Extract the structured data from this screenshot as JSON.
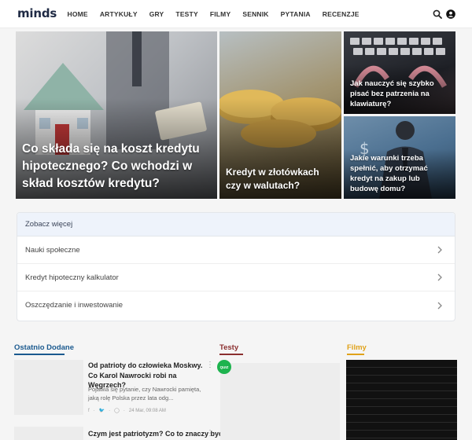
{
  "header": {
    "logo": "minds",
    "nav": [
      "HOME",
      "ARTYKUŁY",
      "GRY",
      "TESTY",
      "FILMY",
      "SENNIK",
      "PYTANIA",
      "RECENZJE"
    ],
    "icons": [
      "search-icon",
      "user-icon"
    ]
  },
  "hero": {
    "main": "Co składa się na koszt kredytu hipotecznego? Co wchodzi w skład kosztów kredytu?",
    "second": "Kredyt w złotówkach czy w walutach?",
    "third": "Jak nauczyć się szybko pisać bez patrzenia na klawiaturę?",
    "fourth": "Jakie warunki trzeba spełnić, aby otrzymać kredyt na zakup lub budowę domu?"
  },
  "more": {
    "title": "Zobacz więcej",
    "items": [
      "Nauki społeczne",
      "Kredyt hipoteczny kalkulator",
      "Oszczędzanie i inwestowanie"
    ]
  },
  "sections": {
    "latest": "Ostatnio Dodane",
    "tests": "Testy",
    "films": "Filmy",
    "quiz_badge": "QUIZ"
  },
  "articles": [
    {
      "title": "Od patrioty do człowieka Moskwy. Co Karol Nawrocki robi na Węgrzech?",
      "desc": "Pojawia się pytanie, czy Nawrocki pamięta, jaką rolę Polska przez lata odg...",
      "date": "24 Mar, 09:08 AM"
    },
    {
      "title": "Czym jest patriotyzm? Co to znaczy być"
    }
  ],
  "colors": {
    "latest": "#1b5a8f",
    "tests": "#8b2f2f",
    "films": "#e0a21a",
    "quiz": "#1db34e"
  }
}
